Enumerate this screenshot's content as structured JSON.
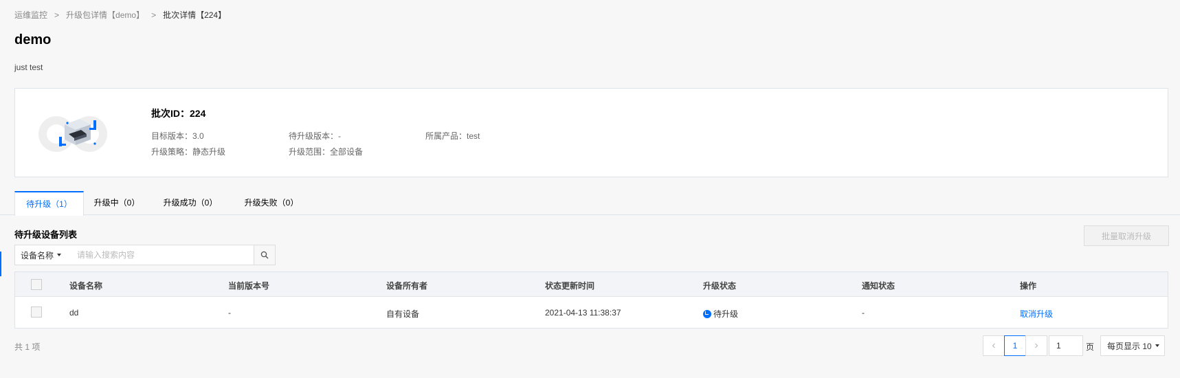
{
  "breadcrumb": {
    "items": [
      "运维监控",
      "升级包详情【demo】",
      "批次详情【224】"
    ],
    "separator": ">"
  },
  "page": {
    "title": "demo",
    "description": "just test"
  },
  "batch": {
    "id_label": "批次ID：224",
    "target_version": "目标版本：3.0",
    "pending_version": "待升级版本：-",
    "product": "所属产品：test",
    "strategy": "升级策略：静态升级",
    "scope": "升级范围：全部设备"
  },
  "tabs": [
    {
      "label": "待升级（1）",
      "active": true
    },
    {
      "label": "升级中（0）",
      "active": false
    },
    {
      "label": "升级成功（0）",
      "active": false
    },
    {
      "label": "升级失败（0）",
      "active": false
    }
  ],
  "list": {
    "title": "待升级设备列表",
    "bulk_cancel_label": "批量取消升级",
    "search": {
      "field_label": "设备名称",
      "placeholder": "请输入搜索内容"
    },
    "columns": [
      "设备名称",
      "当前版本号",
      "设备所有者",
      "状态更新时间",
      "升级状态",
      "通知状态",
      "操作"
    ],
    "rows": [
      {
        "device_name": "dd",
        "current_version": "-",
        "owner": "自有设备",
        "updated_at": "2021-04-13 11:38:37",
        "upgrade_status": "待升级",
        "notify_status": "-",
        "action": "取消升级"
      }
    ]
  },
  "footer": {
    "total": "共 1 项",
    "current_page": "1",
    "page_input_value": "1",
    "page_unit": "页",
    "per_page_label": "每页显示 10"
  },
  "colors": {
    "accent": "#006eff",
    "page_bg": "#f7f7f7"
  },
  "icons": [
    "device-upgrade-illustration",
    "caret-down-icon",
    "search-icon",
    "status-pending-icon",
    "chevron-left-icon",
    "chevron-right-icon"
  ]
}
